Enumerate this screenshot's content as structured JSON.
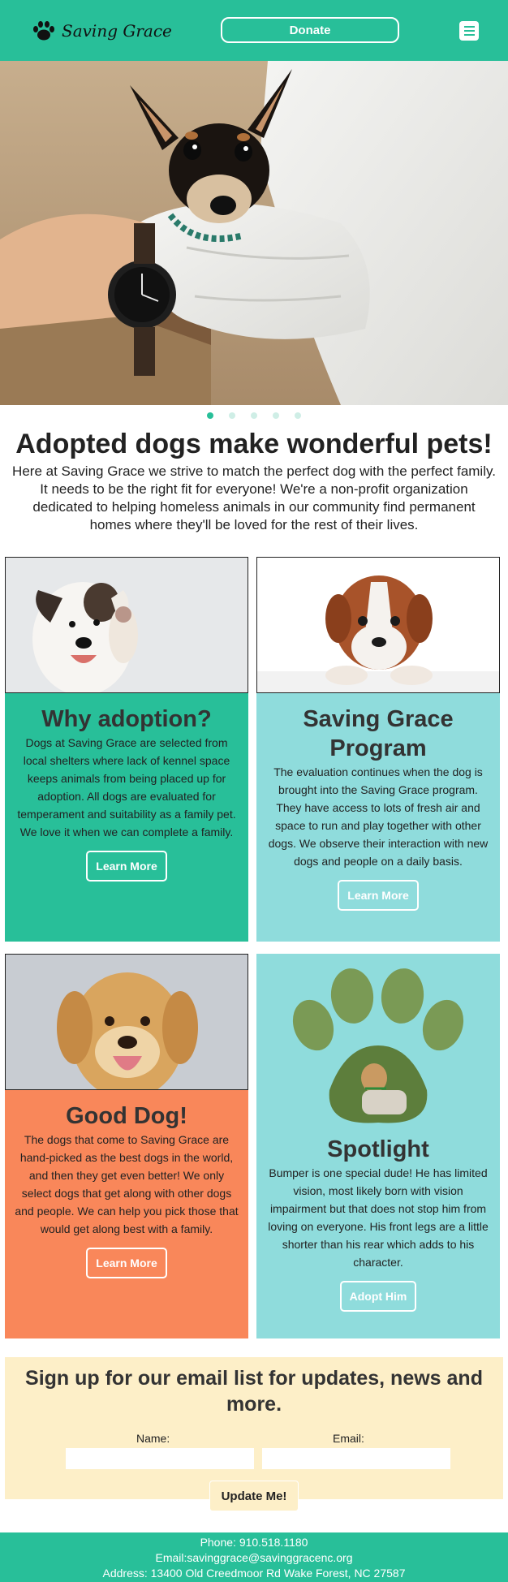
{
  "header": {
    "logo_text": "Saving Grace",
    "donate_label": "Donate",
    "menu_icon": "hamburger-menu-icon",
    "brand_color": "#28bf99"
  },
  "hero": {
    "image": "chihuahua-on-arm-photo",
    "slides": 5,
    "active_slide": 1
  },
  "intro": {
    "title": "Adopted dogs make wonderful pets!",
    "text": "Here at Saving Grace we strive to match the perfect dog with the perfect family. It needs to be the right fit for everyone! We're a non-profit organization dedicated to helping homeless animals in our community find permanent homes where they'll be loved for the rest of their lives."
  },
  "cards": [
    {
      "title": "Why adoption?",
      "text": "Dogs at Saving Grace are selected from local shelters where lack of kennel space keeps animals from being placed up for adoption. All dogs are evaluated for temperament and suitability as a family pet. We love it when we can complete a family.",
      "button": "Learn More",
      "color": "#28bf99",
      "image": "waving-dog-photo"
    },
    {
      "title": "Saving Grace Program",
      "text": "The evaluation continues when the dog is brought into the Saving Grace program. They have access to lots of fresh air and space to run and play together with other dogs. We observe their interaction with new dogs and people on a daily basis.",
      "button": "Learn More",
      "color": "#8fdcdc",
      "image": "puppy-peeking-photo"
    },
    {
      "title": "Good Dog!",
      "text": "The dogs that come to Saving Grace are hand-picked as the best dogs in the world, and then they get even better! We only select dogs that get along with other dogs and people. We can help you pick those that would get along best with a family.",
      "button": "Learn More",
      "color": "#f9875a",
      "image": "golden-retriever-photo"
    },
    {
      "title": "Spotlight",
      "text": "Bumper is one special dude! He has limited vision, most likely born with vision impairment but that does not stop him from loving on everyone. His front legs are a little shorter than his rear which adds to his character.",
      "button": "Adopt Him",
      "color": "#8fdcdc",
      "image": "paw-print-photo"
    }
  ],
  "signup": {
    "title": "Sign up for our email list for updates, news and more.",
    "name_label": "Name:",
    "email_label": "Email:",
    "name_value": "",
    "email_value": "",
    "button": "Update Me!"
  },
  "footer": {
    "phone": "Phone: 910.518.1180",
    "email": "Email:savinggrace@savinggracenc.org",
    "address": "Address: 13400 Old Creedmoor Rd Wake Forest, NC 27587"
  }
}
